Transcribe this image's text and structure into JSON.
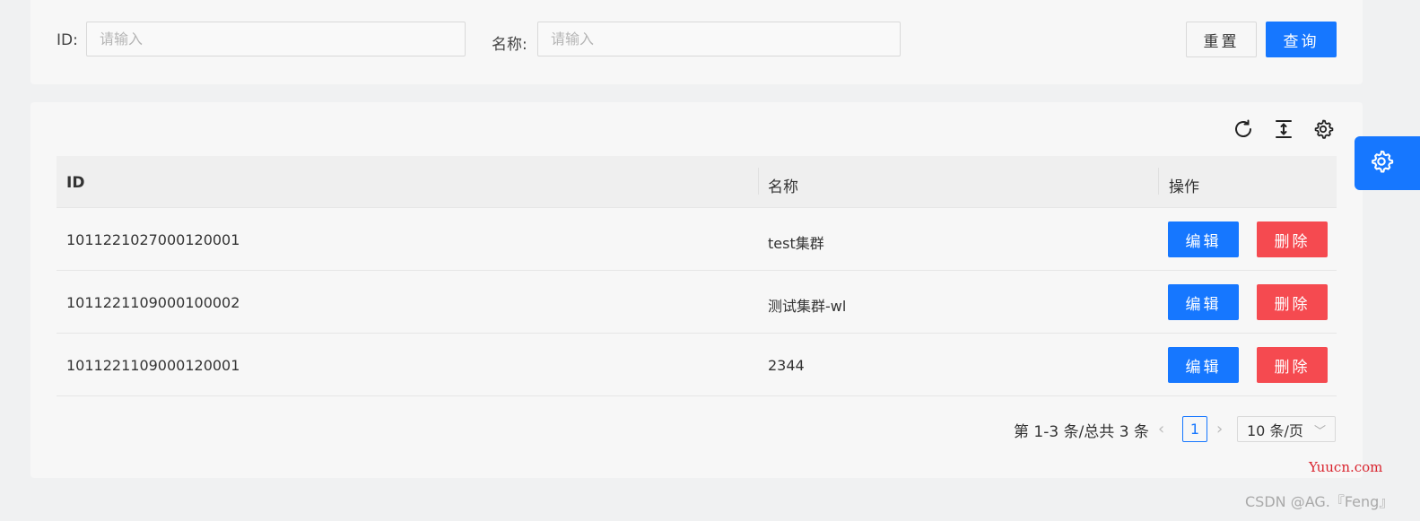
{
  "search": {
    "id_label": "ID:",
    "id_placeholder": "请输入",
    "id_value": "",
    "name_label": "名称:",
    "name_placeholder": "请输入",
    "name_value": "",
    "reset_label": "重置",
    "query_label": "查询"
  },
  "toolbar": {
    "refresh_icon": "refresh-icon",
    "density_icon": "column-height-icon",
    "settings_icon": "gear-icon"
  },
  "table": {
    "columns": [
      "ID",
      "名称",
      "操作"
    ],
    "rows": [
      {
        "id": "1011221027000120001",
        "name": "test集群",
        "edit": "编辑",
        "delete": "删除"
      },
      {
        "id": "1011221109000100002",
        "name": "测试集群-wl",
        "edit": "编辑",
        "delete": "删除"
      },
      {
        "id": "1011221109000120001",
        "name": "2344",
        "edit": "编辑",
        "delete": "删除"
      }
    ]
  },
  "pagination": {
    "total_text": "第 1-3 条/总共 3 条",
    "current_page": "1",
    "page_size": "10 条/页",
    "prev": "‹",
    "next": "›"
  },
  "watermark": {
    "site": "Yuucn.com",
    "author": "CSDN @AG.『Feng』"
  },
  "colors": {
    "primary": "#1677ff",
    "danger": "#f54a50",
    "background": "#f0f1f2",
    "card": "#f7f7f7"
  }
}
